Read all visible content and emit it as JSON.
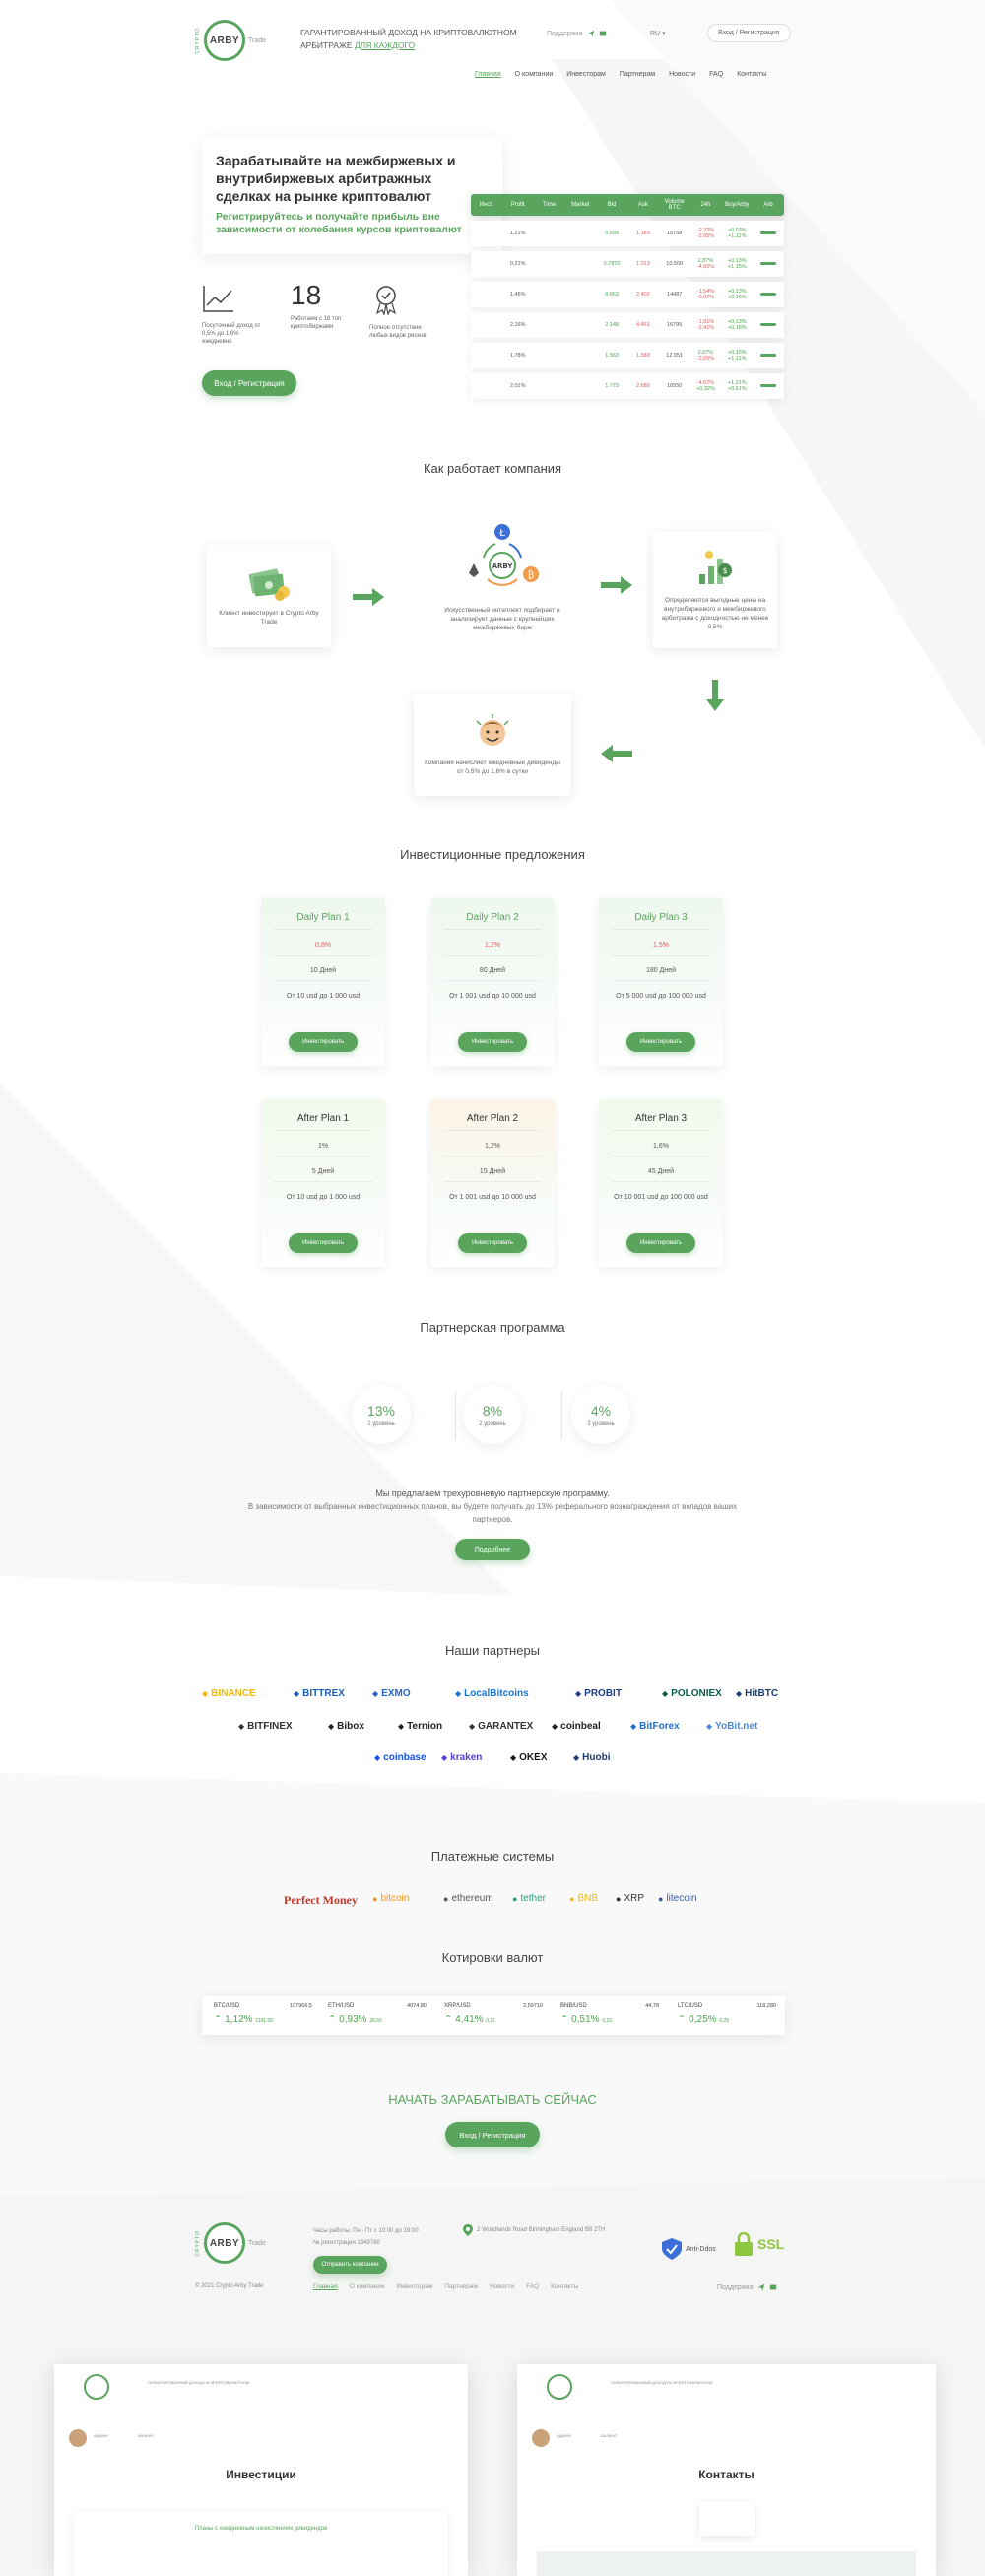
{
  "header": {
    "logo_main": "ARBY",
    "logo_side": "CRYPTO",
    "logo_tail": "Trade",
    "tagline_line1": "ГАРАНТИРОВАННЫЙ ДОХОД НА КРИПТОВАЛЮТНОМ",
    "tagline_line2a": "АРБИТРАЖЕ ",
    "tagline_line2b": "ДЛЯ КАЖДОГО",
    "support": "Поддержка",
    "lang": "RU",
    "login": "Вход / Регистрация",
    "nav": [
      "Главная",
      "О компании",
      "Инвесторам",
      "Партнерам",
      "Новости",
      "FAQ",
      "Контакты"
    ]
  },
  "hero": {
    "title": "Зарабатывайте на межбиржевых и внутрибиржевых арбитражных сделках на рынке криптовалют",
    "subtitle": "Регистрируйтесь и получайте прибыль вне зависимости от колебания курсов криптовалют",
    "stats": [
      {
        "icon": "chart-icon",
        "value": "",
        "caption": "Посуточный доход от 0,5% до 1,6% ежедневно"
      },
      {
        "icon": "",
        "value": "18",
        "caption": "Работаем с 18 топ криптобиржами"
      },
      {
        "icon": "award-icon",
        "value": "",
        "caption": "Полное отсутствие любых видов рисков"
      }
    ],
    "cta": "Вход / Регистрация"
  },
  "arb_table": {
    "headers": [
      "Инст.",
      "Profit",
      "Time",
      "Market",
      "Bid",
      "Ask",
      "Volume BTC",
      "24h",
      "Buy/Arby",
      "Arb"
    ],
    "rows": [
      [
        "",
        "1,21%",
        "",
        "",
        "0.993",
        "1.183",
        "18758",
        "-2,22%",
        "+0,03%",
        ""
      ],
      [
        "",
        "0,21%",
        "",
        "",
        "0.7870",
        "1.013",
        "10.500",
        "2,87%",
        "+0,13%",
        ""
      ],
      [
        "",
        "1,45%",
        "",
        "",
        "0.863",
        "2.402",
        "14487",
        "-1,54%",
        "+0,13%",
        ""
      ],
      [
        "",
        "2,16%",
        "",
        "",
        "2.148",
        "4.461",
        "16795",
        "-1,91%",
        "+0,13%",
        ""
      ],
      [
        "",
        "1,78%",
        "",
        "",
        "1.563",
        "1.583",
        "12.051",
        "2,07%",
        "+0,15%",
        ""
      ],
      [
        "",
        "2,01%",
        "",
        "",
        "1.773",
        "2.680",
        "10550",
        "-4,67%",
        "+1,31%",
        ""
      ]
    ],
    "rows_sub": [
      [
        "-2,05%",
        "+1,11%"
      ],
      [
        "-4,50%",
        "+1,15%"
      ],
      [
        "-0,07%",
        "+0,16%"
      ],
      [
        "-2,41%",
        "+0,16%"
      ],
      [
        "-2,05%",
        "+1,11%"
      ],
      [
        "+0,32%",
        "+0,61%"
      ]
    ]
  },
  "how": {
    "title": "Как работает компания",
    "steps": [
      "Клиент инвестирует в Crypto Arby Trade",
      "Искусственный интеллект подбирает и анализирует данные с крупнейших межбиржевых бирж",
      "Определяются выгодные цены на внутрибиржевого и межбиржевого арбитража с доходностью не менее 0,5%",
      "Компания начисляет ежедневные дивиденды от 0,5% до 1,6% в сутки"
    ],
    "circle_label": "ARBY"
  },
  "plans": {
    "title": "Инвестиционные предложения",
    "items": [
      {
        "name": "Daily Plan 1",
        "rate": "0,8%",
        "days": "10 Дней",
        "range": "От 10 usd до 1 000 usd",
        "btn": "Инвестировать"
      },
      {
        "name": "Daily Plan 2",
        "rate": "1,2%",
        "days": "80 Дней",
        "range": "От 1 001 usd до 10 000 usd",
        "btn": "Инвестировать"
      },
      {
        "name": "Daily Plan 3",
        "rate": "1,5%",
        "days": "180 Дней",
        "range": "От 5 000 usd до 100 000 usd",
        "btn": "Инвестировать"
      },
      {
        "name": "After Plan 1",
        "rate": "1%",
        "days": "5 Дней",
        "range": "От 10 usd до 1 000 usd",
        "btn": "Инвестировать"
      },
      {
        "name": "After Plan 2",
        "rate": "1,2%",
        "days": "15 Дней",
        "range": "От 1 001 usd до 10 000 usd",
        "btn": "Инвестировать"
      },
      {
        "name": "After Plan 3",
        "rate": "1,6%",
        "days": "45 Дней",
        "range": "От 10 001 usd до 100 000 usd",
        "btn": "Инвестировать"
      }
    ]
  },
  "partner_program": {
    "title": "Партнерская программа",
    "levels": [
      {
        "value": "13%",
        "label": "1 уровень"
      },
      {
        "value": "8%",
        "label": "2 уровень"
      },
      {
        "value": "4%",
        "label": "3 уровень"
      }
    ],
    "text1": "Мы предлагаем трехуровневую партнерскую программу.",
    "text2": "В зависимости от выбранных инвестиционных планов, вы будете получать до 13% реферального вознаграждения от вкладов ваших",
    "text3": "партнеров.",
    "btn": "Подробнее"
  },
  "partners": {
    "title": "Наши партнеры",
    "row1": [
      "BINANCE",
      "BITTREX",
      "EXMO",
      "LocalBitcoins",
      "PROBIT",
      "POLONIEX",
      "HitBTC"
    ],
    "row2": [
      "BITFINEX",
      "Bibox",
      "Ternion",
      "GARANTEX",
      "coinbeal",
      "BitForex",
      "YoBit.net"
    ],
    "row3": [
      "coinbase",
      "kraken",
      "OKEX",
      "Huobi"
    ]
  },
  "payments": {
    "title": "Платежные системы",
    "items": [
      "Perfect Money",
      "bitcoin",
      "ethereum",
      "tether",
      "BNB",
      "XRP",
      "litecoin"
    ]
  },
  "quotes": {
    "title": "Котировки валют",
    "items": [
      {
        "pair": "BTC/USD",
        "price": "107966,5",
        "change": "1,12%",
        "sub": "1191,00"
      },
      {
        "pair": "ETH/USD",
        "price": "4074,80",
        "change": "0,93%",
        "sub": "36,56"
      },
      {
        "pair": "XRP/USD",
        "price": "2,59710",
        "change": "4,41%",
        "sub": "0,11"
      },
      {
        "pair": "BNB/USD",
        "price": "44,78",
        "change": "0,51%",
        "sub": "0,23"
      },
      {
        "pair": "LTC/USD",
        "price": "118,280",
        "change": "0,25%",
        "sub": "0,29"
      }
    ]
  },
  "cta_section": {
    "title": "НАЧАТЬ ЗАРАБАТЫВАТЬ СЕЙЧАС",
    "btn": "Вход / Регистрация"
  },
  "footer": {
    "hours": "Часы работы: Пн - Пт с 10:00 до 19:00",
    "reg": "№ регистрации 1349780",
    "contact_btn": "Отправить компании",
    "address": "2 Woodlands Road Birmingham England B8 2TH",
    "antiddos": "Anti-Ddos",
    "ssl": "SSL",
    "support": "Поддержка",
    "copyright": "© 2021 Crypto Arby Trade",
    "nav": [
      "Главная",
      "О компании",
      "Инвесторам",
      "Партнерам",
      "Новости",
      "FAQ",
      "Контакты"
    ]
  },
  "previews": {
    "left_title": "Инвестиции",
    "right_title": "Контакты",
    "left_user": "АДМИН",
    "left_balance": "БАЛАНС",
    "left_note": "Планы с ежедневным начислением дивидендов"
  }
}
